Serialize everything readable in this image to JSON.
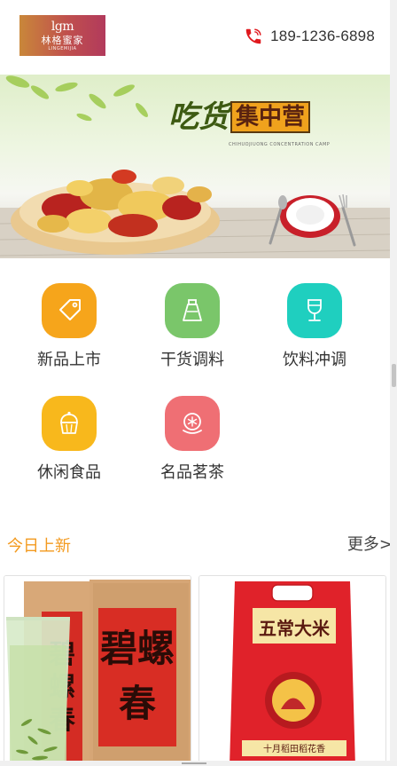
{
  "header": {
    "logo": {
      "mark": "lgm",
      "name": "林格蜜家",
      "sub": "LINGEMIJIA"
    },
    "phone": "189-1236-6898"
  },
  "banner": {
    "title_green": "吃货",
    "title_box": "集中营",
    "subtitle": "CHIHUOJIUONG CONCENTRATION CAMP"
  },
  "categories": [
    {
      "label": "新品上市",
      "icon": "tag-icon",
      "color": "#f6a51b"
    },
    {
      "label": "干货调料",
      "icon": "seasoning-jar-icon",
      "color": "#7ac66a"
    },
    {
      "label": "饮料冲调",
      "icon": "wine-glass-icon",
      "color": "#1fcfbf"
    },
    {
      "label": "休闲食品",
      "icon": "cupcake-icon",
      "color": "#f8b81c"
    },
    {
      "label": "名品茗茶",
      "icon": "tea-cup-icon",
      "color": "#ef6f74"
    }
  ],
  "section": {
    "title": "今日上新",
    "more": "更多>"
  },
  "products": [
    {
      "name": "碧螺春",
      "image": "biluochun-tea-package"
    },
    {
      "name": "五常大米",
      "image": "wuchang-rice-bag",
      "tagline": "十月稻田稻花香"
    }
  ],
  "colors": {
    "accent": "#f39a1f",
    "phone_icon": "#e0191e"
  }
}
